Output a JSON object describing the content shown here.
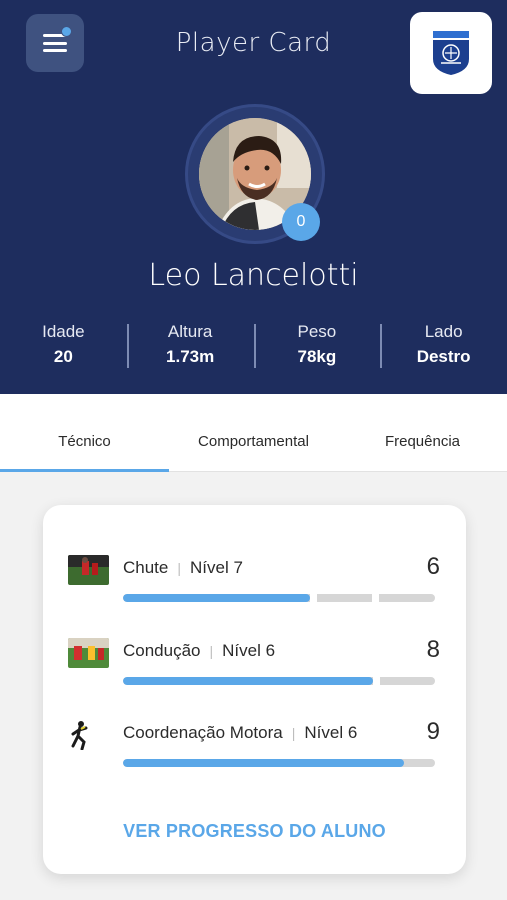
{
  "header": {
    "title": "Player Card"
  },
  "player": {
    "name": "Leo Lancelotti",
    "badge_count": "0",
    "stats": [
      {
        "label": "Idade",
        "value": "20"
      },
      {
        "label": "Altura",
        "value": "1.73m"
      },
      {
        "label": "Peso",
        "value": "78kg"
      },
      {
        "label": "Lado",
        "value": "Destro"
      }
    ]
  },
  "tabs": [
    {
      "label": "Técnico",
      "active": true
    },
    {
      "label": "Comportamental",
      "active": false
    },
    {
      "label": "Frequência",
      "active": false
    }
  ],
  "skills": [
    {
      "name": "Chute",
      "level": "Nível 7",
      "score": "6",
      "progress": 0.6
    },
    {
      "name": "Condução",
      "level": "Nível 6",
      "score": "8",
      "progress": 0.8
    },
    {
      "name": "Coordenação Motora",
      "level": "Nível 6",
      "score": "9",
      "progress": 0.9
    }
  ],
  "card": {
    "progress_link": "VER PROGRESSO DO ALUNO"
  },
  "colors": {
    "header_bg": "#1e2d5e",
    "accent": "#5aa7e8",
    "bar_bg": "#d6d6d6"
  }
}
